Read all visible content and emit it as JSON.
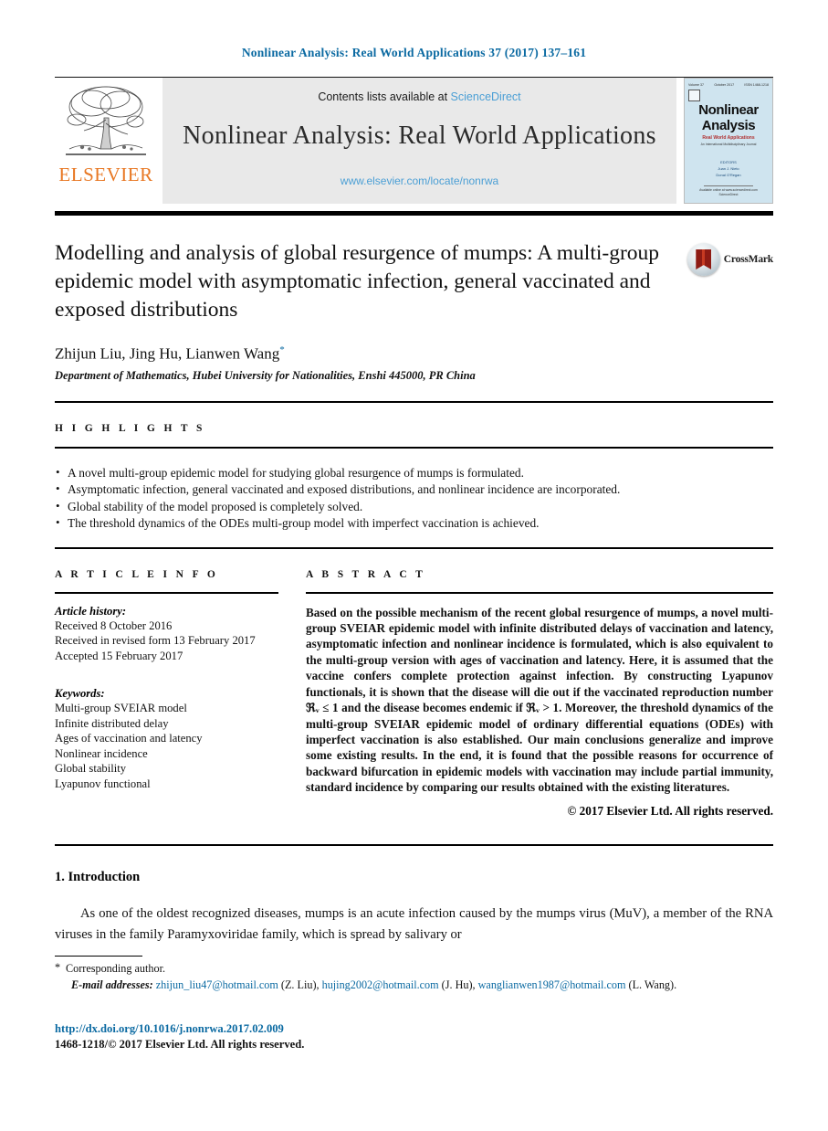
{
  "running_head": "Nonlinear Analysis: Real World Applications 37 (2017) 137–161",
  "masthead": {
    "publisher_wordmark": "ELSEVIER",
    "contents_prefix": "Contents lists available at ",
    "contents_link": "ScienceDirect",
    "journal_name": "Nonlinear Analysis: Real World Applications",
    "journal_url": "www.elsevier.com/locate/nonrwa",
    "cover": {
      "volume": "Volume 37",
      "date": "October 2017",
      "issn": "ISSN 1468-1218",
      "title_line1": "Nonlinear",
      "title_line2": "Analysis",
      "subtitle": "Real World Applications",
      "subtitle2": "An International Multidisciplinary Journal",
      "editors_line1": "EDITORS",
      "editors_line2": "Juan J. Nieto",
      "editors_line3": "Donal O'Regan",
      "footer1": "Available online at www.sciencedirect.com",
      "footer2": "ScienceDirect"
    }
  },
  "article": {
    "title": "Modelling and analysis of global resurgence of mumps: A multi-group epidemic model with asymptomatic infection, general vaccinated and exposed distributions",
    "crossmark_label": "CrossMark",
    "authors": "Zhijun Liu, Jing Hu, Lianwen Wang",
    "author_star": "*",
    "affiliation": "Department of Mathematics, Hubei University for Nationalities, Enshi 445000, PR China"
  },
  "highlights": {
    "label": "H I G H L I G H T S",
    "items": [
      "A novel multi-group epidemic model for studying global resurgence of mumps is formulated.",
      "Asymptomatic infection, general vaccinated and exposed distributions, and nonlinear incidence are incorporated.",
      "Global stability of the model proposed is completely solved.",
      "The threshold dynamics of the ODEs multi-group model with imperfect vaccination is achieved."
    ]
  },
  "article_info": {
    "label": "A R T I C L E   I N F O",
    "history_label": "Article history:",
    "history": [
      "Received 8 October 2016",
      "Received in revised form 13 February 2017",
      "Accepted 15 February 2017"
    ],
    "keywords_label": "Keywords:",
    "keywords": [
      "Multi-group SVEIAR model",
      "Infinite distributed delay",
      "Ages of vaccination and latency",
      "Nonlinear incidence",
      "Global stability",
      "Lyapunov functional"
    ]
  },
  "abstract": {
    "label": "A B S T R A C T",
    "text": "Based on the possible mechanism of the recent global resurgence of mumps, a novel multi-group SVEIAR epidemic model with infinite distributed delays of vaccination and latency, asymptomatic infection and nonlinear incidence is formulated, which is also equivalent to the multi-group version with ages of vaccination and latency. Here, it is assumed that the vaccine confers complete protection against infection. By constructing Lyapunov functionals, it is shown that the disease will die out if the vaccinated reproduction number ℜᵥ ≤ 1 and the disease becomes endemic if ℜᵥ > 1. Moreover, the threshold dynamics of the multi-group SVEIAR epidemic model of ordinary differential equations (ODEs) with imperfect vaccination is also established. Our main conclusions generalize and improve some existing results. In the end, it is found that the possible reasons for occurrence of backward bifurcation in epidemic models with vaccination may include partial immunity, standard incidence by comparing our results obtained with the existing literatures.",
    "copyright": "© 2017 Elsevier Ltd. All rights reserved."
  },
  "introduction": {
    "heading": "1.  Introduction",
    "paragraph": "As one of the oldest recognized diseases, mumps is an acute infection caused by the mumps virus (MuV), a member of the RNA viruses in the family Paramyxoviridae family, which is spread by salivary or"
  },
  "footnotes": {
    "corresponding_star": "*",
    "corresponding": "Corresponding author.",
    "emails_label": "E-mail addresses:",
    "emails": [
      {
        "address": "zhijun_liu47@hotmail.com",
        "person": "(Z. Liu),"
      },
      {
        "address": "hujing2002@hotmail.com",
        "person": "(J. Hu),"
      },
      {
        "address": "wanglianwen1987@hotmail.com",
        "person": ""
      }
    ],
    "emails_tail": "(L. Wang)."
  },
  "footer": {
    "doi": "http://dx.doi.org/10.1016/j.nonrwa.2017.02.009",
    "issn_line": "1468-1218/© 2017 Elsevier Ltd. All rights reserved."
  },
  "colors": {
    "link": "#0b6aa2",
    "elsevier_orange": "#e87722",
    "sciencedirect_blue": "#4b9fd5",
    "cover_bg": "#cfe4ef"
  }
}
